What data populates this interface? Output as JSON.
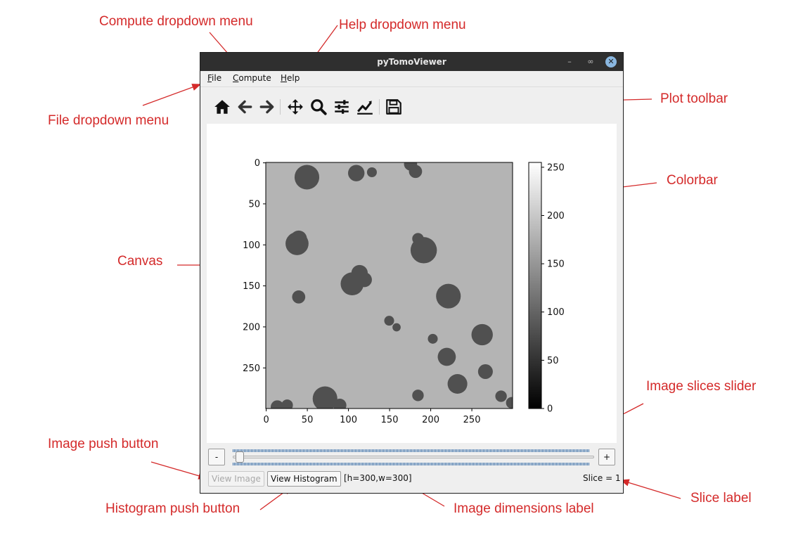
{
  "annotations": {
    "compute_menu": "Compute dropdown menu",
    "help_menu": "Help dropdown menu",
    "file_menu": "File dropdown menu",
    "plot_toolbar": "Plot toolbar",
    "colorbar": "Colorbar",
    "canvas": "Canvas",
    "slices_slider": "Image slices slider",
    "image_button": "Image push button",
    "histogram_button": "Histogram push button",
    "dimensions_label": "Image dimensions label",
    "slice_label": "Slice label",
    "color": "#d42a2a"
  },
  "window": {
    "title": "pyTomoViewer",
    "controls": [
      "minimize-icon",
      "restore-icon",
      "close-icon"
    ]
  },
  "menubar": {
    "file": {
      "underlined": "F",
      "rest": "ile"
    },
    "compute": {
      "underlined": "C",
      "rest": "ompute"
    },
    "help": {
      "underlined": "H",
      "rest": "elp"
    }
  },
  "toolbar": {
    "icons": [
      "home-icon",
      "back-arrow-icon",
      "forward-arrow-icon",
      "pan-icon",
      "zoom-icon",
      "subplots-config-icon",
      "edit-curve-icon",
      "save-icon"
    ]
  },
  "chart_data": {
    "type": "heatmap",
    "colormap": "gray",
    "x_ticks": [
      "0",
      "50",
      "100",
      "150",
      "200",
      "250"
    ],
    "y_ticks": [
      "0",
      "50",
      "100",
      "150",
      "200",
      "250"
    ],
    "xlim": [
      0,
      299
    ],
    "ylim": [
      299,
      0
    ],
    "colorbar_ticks": [
      "0",
      "50",
      "100",
      "150",
      "200",
      "250"
    ],
    "colorbar_range": [
      0,
      255
    ],
    "background_value": 180,
    "particle_value": 80,
    "particles": [
      [
        14,
        298,
        8
      ],
      [
        26,
        296,
        7
      ],
      [
        50,
        18,
        15
      ],
      [
        72,
        288,
        15
      ],
      [
        110,
        13,
        10
      ],
      [
        120,
        143,
        9
      ],
      [
        129,
        12,
        6
      ],
      [
        192,
        107,
        16
      ],
      [
        203,
        215,
        6
      ],
      [
        217,
        237,
        7
      ],
      [
        222,
        163,
        15
      ],
      [
        38,
        99,
        14
      ],
      [
        40,
        93,
        10
      ],
      [
        105,
        148,
        14
      ],
      [
        114,
        135,
        10
      ],
      [
        176,
        2,
        8
      ],
      [
        182,
        11,
        8
      ],
      [
        185,
        93,
        7
      ],
      [
        185,
        284,
        7
      ],
      [
        40,
        164,
        8
      ],
      [
        150,
        193,
        6
      ],
      [
        159,
        201,
        5
      ],
      [
        220,
        237,
        11
      ],
      [
        233,
        270,
        12
      ],
      [
        263,
        210,
        13
      ],
      [
        267,
        255,
        9
      ],
      [
        286,
        285,
        7
      ],
      [
        299,
        293,
        7
      ],
      [
        90,
        296,
        8
      ]
    ]
  },
  "slider": {
    "minus_label": "-",
    "plus_label": "+",
    "value": 1,
    "min": 1
  },
  "bottom": {
    "view_image_label": "View Image",
    "view_histogram_label": "View Histogram",
    "dimensions": "[h=300,w=300]",
    "slice": "Slice = 1"
  }
}
